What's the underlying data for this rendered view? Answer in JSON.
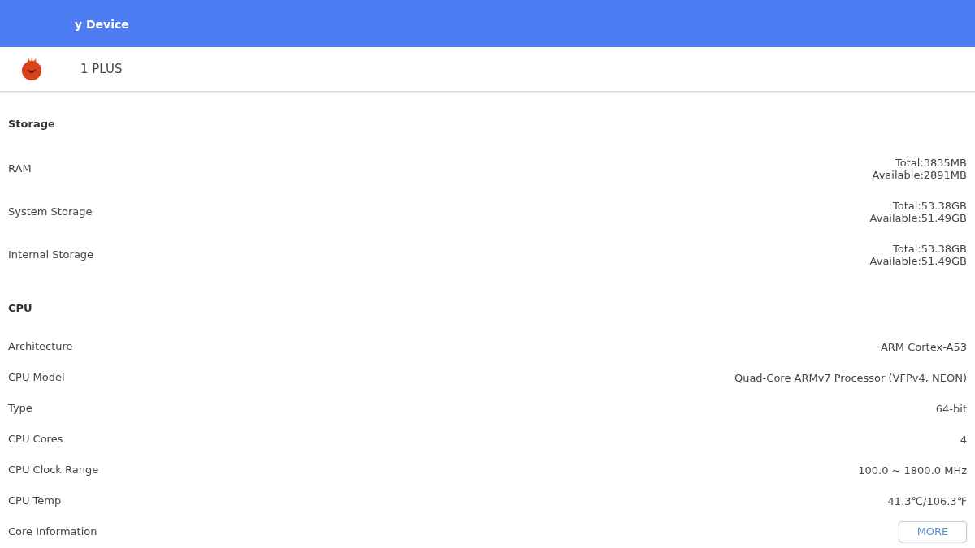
{
  "header": {
    "title": "y Device"
  },
  "device": {
    "name": "1 PLUS"
  },
  "sections": [
    {
      "title": "Storage",
      "rows": [
        {
          "kind": "text",
          "label": "RAM",
          "values": [
            "Total:3835MB",
            "Available:2891MB"
          ]
        },
        {
          "kind": "text",
          "label": "System Storage",
          "values": [
            "Total:53.38GB",
            "Available:51.49GB"
          ]
        },
        {
          "kind": "text",
          "label": "Internal Storage",
          "values": [
            "Total:53.38GB",
            "Available:51.49GB"
          ]
        }
      ]
    },
    {
      "title": "CPU",
      "rows": [
        {
          "kind": "text",
          "label": "Architecture",
          "values": [
            "ARM Cortex-A53"
          ]
        },
        {
          "kind": "text",
          "label": "CPU Model",
          "values": [
            "Quad-Core ARMv7 Processor (VFPv4, NEON)"
          ]
        },
        {
          "kind": "text",
          "label": "Type",
          "values": [
            "64-bit"
          ]
        },
        {
          "kind": "text",
          "label": "CPU Cores",
          "values": [
            "4"
          ]
        },
        {
          "kind": "text",
          "label": "CPU Clock Range",
          "values": [
            "100.0 ~ 1800.0 MHz"
          ]
        },
        {
          "kind": "text",
          "label": "CPU Temp",
          "values": [
            "41.3℃/106.3℉"
          ]
        },
        {
          "kind": "button",
          "label": "Core Information",
          "values": [
            "MORE"
          ]
        }
      ]
    }
  ]
}
